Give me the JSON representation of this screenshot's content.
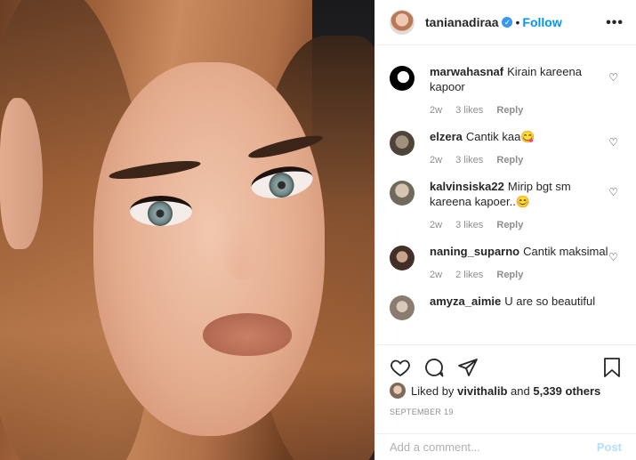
{
  "post": {
    "author": "tanianadiraa",
    "follow_label": "Follow",
    "dot": "•",
    "more_label": "•••"
  },
  "comments": [
    {
      "user": "marwahasnaf",
      "text": "Kirain kareena kapoor",
      "age": "2w",
      "likes": "3 likes",
      "reply": "Reply"
    },
    {
      "user": "elzera",
      "text": "Cantik kaa😋",
      "age": "2w",
      "likes": "3 likes",
      "reply": "Reply"
    },
    {
      "user": "kalvinsiska22",
      "text": "Mirip bgt sm kareena kapoer..😊",
      "age": "2w",
      "likes": "3 likes",
      "reply": "Reply"
    },
    {
      "user": "naning_suparno",
      "text": "Cantik maksimal",
      "age": "2w",
      "likes": "2 likes",
      "reply": "Reply"
    },
    {
      "user": "amyza_aimie",
      "text": "U are so beautiful",
      "age": "",
      "likes": "",
      "reply": ""
    }
  ],
  "likes": {
    "prefix": "Liked by",
    "user": "vivithalib",
    "and": "and",
    "others": "5,339 others"
  },
  "date": "SEPTEMBER 19",
  "add_comment": {
    "placeholder": "Add a comment...",
    "post_label": "Post"
  },
  "colors": {
    "accent": "#0095f6",
    "post_disabled": "#b2dffc",
    "meta_gray": "#8e8e8e"
  }
}
